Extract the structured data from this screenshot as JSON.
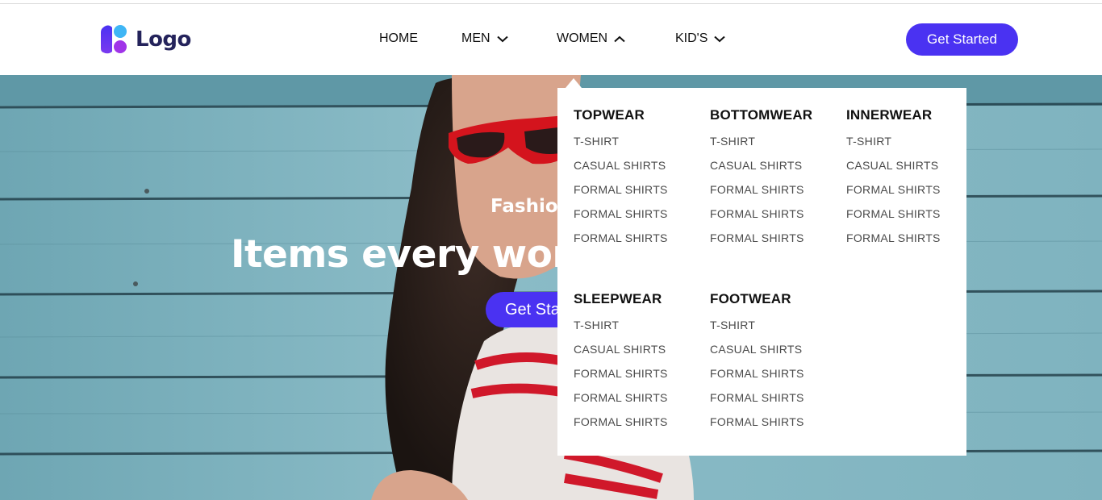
{
  "header": {
    "logo_text": "Logo",
    "nav": [
      {
        "label": "HOME",
        "icon": null
      },
      {
        "label": "MEN",
        "icon": "chevron-down-icon"
      },
      {
        "label": "WOMEN",
        "icon": "chevron-up-icon"
      },
      {
        "label": "KID'S",
        "icon": "chevron-down-icon"
      }
    ],
    "cta_label": "Get Started"
  },
  "hero": {
    "subtitle": "Fashion",
    "title": "Items every wom",
    "cta_label": "Get Started"
  },
  "mega_menu": {
    "columns": [
      {
        "heading": "TOPWEAR",
        "items": [
          "T-SHIRT",
          "CASUAL SHIRTS",
          "FORMAL SHIRTS",
          "FORMAL SHIRTS",
          "FORMAL SHIRTS"
        ]
      },
      {
        "heading": "BOTTOMWEAR",
        "items": [
          "T-SHIRT",
          "CASUAL SHIRTS",
          "FORMAL SHIRTS",
          "FORMAL SHIRTS",
          "FORMAL SHIRTS"
        ]
      },
      {
        "heading": "INNERWEAR",
        "items": [
          "T-SHIRT",
          "CASUAL SHIRTS",
          "FORMAL SHIRTS",
          "FORMAL SHIRTS",
          "FORMAL SHIRTS"
        ]
      },
      {
        "heading": "SLEEPWEAR",
        "items": [
          "T-SHIRT",
          "CASUAL SHIRTS",
          "FORMAL SHIRTS",
          "FORMAL SHIRTS",
          "FORMAL SHIRTS"
        ]
      },
      {
        "heading": "FOOTWEAR",
        "items": [
          "T-SHIRT",
          "CASUAL SHIRTS",
          "FORMAL SHIRTS",
          "FORMAL SHIRTS",
          "FORMAL SHIRTS"
        ]
      }
    ]
  },
  "colors": {
    "accent": "#4a32f2",
    "logo_text": "#24235b",
    "hero_bg": "#7fb1bd"
  }
}
